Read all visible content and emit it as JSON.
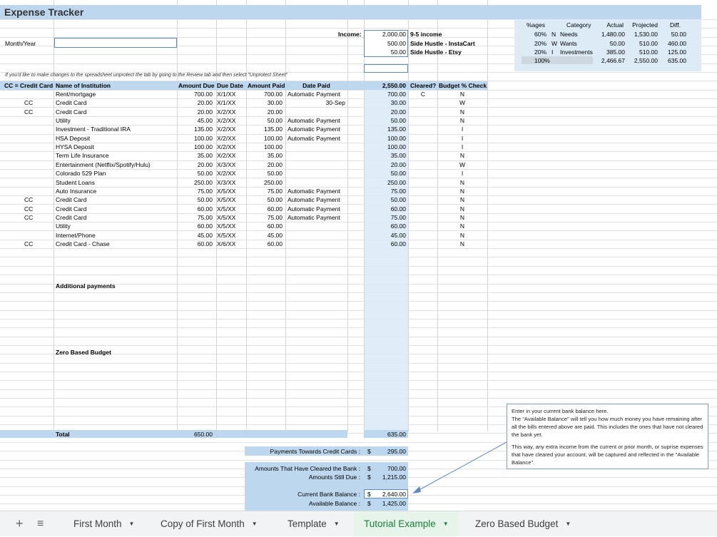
{
  "title": "Expense Tracker",
  "month_year_label": "Month/Year",
  "month_year_value": "",
  "income": {
    "label": "Income:",
    "rows": [
      {
        "amount": "2,000.00",
        "source": "9-5 income"
      },
      {
        "amount": "500.00",
        "source": "Side Hustle - InstaCart"
      },
      {
        "amount": "50.00",
        "source": "Side Hustle - Etsy"
      }
    ]
  },
  "budget_summary": {
    "headers": [
      "%ages",
      "Category",
      "Actual",
      "Projected",
      "Diff."
    ],
    "rows": [
      {
        "pct": "60%",
        "code": "N",
        "category": "Needs",
        "actual": "1,480.00",
        "projected": "1,530.00",
        "diff": "50.00"
      },
      {
        "pct": "20%",
        "code": "W",
        "category": "Wants",
        "actual": "50.00",
        "projected": "510.00",
        "diff": "460.00"
      },
      {
        "pct": "20%",
        "code": "I",
        "category": "Investments",
        "actual": "385.00",
        "projected": "510.00",
        "diff": "125.00"
      }
    ],
    "total": {
      "pct": "100%",
      "actual": "2,466.67",
      "projected": "2,550.00",
      "diff": "635.00"
    }
  },
  "instruction": "If you'd like to make changes to the spreadsheet unprotect the tab by going to the Review tab and then select \"Unprotect Sheet\"",
  "table": {
    "headers": {
      "cc": "CC = Credit Card",
      "name": "Name of Institution",
      "due": "Amount Due",
      "date": "Due Date",
      "paid": "Amount Paid",
      "datepaid": "Date Paid",
      "balance": "2,550.00",
      "cleared": "Cleared?",
      "check": "Budget % Check"
    },
    "rows": [
      {
        "cc": "",
        "name": "Rent/mortgage",
        "due": "700.00",
        "date": "X/1/XX",
        "paid": "700.00",
        "note": "Automatic Payment",
        "bal": "700.00",
        "cleared": "C",
        "check": "N"
      },
      {
        "cc": "CC",
        "name": "Credit Card",
        "due": "20.00",
        "date": "X/1/XX",
        "paid": "30.00",
        "note": "30-Sep",
        "bal": "30.00",
        "cleared": "",
        "check": "W"
      },
      {
        "cc": "CC",
        "name": "Credit Card",
        "due": "20.00",
        "date": "X/2/XX",
        "paid": "20.00",
        "note": "",
        "bal": "20.00",
        "cleared": "",
        "check": "N"
      },
      {
        "cc": "",
        "name": "Utility",
        "due": "45.00",
        "date": "X/2/XX",
        "paid": "50.00",
        "note": "Automatic Payment",
        "bal": "50.00",
        "cleared": "",
        "check": "N"
      },
      {
        "cc": "",
        "name": "Investment - Traditional IRA",
        "due": "135.00",
        "date": "X/2/XX",
        "paid": "135.00",
        "note": "Automatic Payment",
        "bal": "135.00",
        "cleared": "",
        "check": "I"
      },
      {
        "cc": "",
        "name": "HSA Deposit",
        "due": "100.00",
        "date": "X/2/XX",
        "paid": "100.00",
        "note": "Automatic Payment",
        "bal": "100.00",
        "cleared": "",
        "check": "I"
      },
      {
        "cc": "",
        "name": "HYSA Deposit",
        "due": "100.00",
        "date": "X/2/XX",
        "paid": "100.00",
        "note": "",
        "bal": "100.00",
        "cleared": "",
        "check": "I"
      },
      {
        "cc": "",
        "name": "Term Life Insurance",
        "due": "35.00",
        "date": "X/2/XX",
        "paid": "35.00",
        "note": "",
        "bal": "35.00",
        "cleared": "",
        "check": "N"
      },
      {
        "cc": "",
        "name": "Entertainment (Netflix/Spotify/Hulu)",
        "due": "20.00",
        "date": "X/3/XX",
        "paid": "20.00",
        "note": "",
        "bal": "20.00",
        "cleared": "",
        "check": "W"
      },
      {
        "cc": "",
        "name": "Colorado 529 Plan",
        "due": "50.00",
        "date": "X/2/XX",
        "paid": "50.00",
        "note": "",
        "bal": "50.00",
        "cleared": "",
        "check": "I"
      },
      {
        "cc": "",
        "name": "Student Loans",
        "due": "250.00",
        "date": "X/3/XX",
        "paid": "250.00",
        "note": "",
        "bal": "250.00",
        "cleared": "",
        "check": "N"
      },
      {
        "cc": "",
        "name": "Auto Insurance",
        "due": "75.00",
        "date": "X/5/XX",
        "paid": "75.00",
        "note": "Automatic Payment",
        "bal": "75.00",
        "cleared": "",
        "check": "N"
      },
      {
        "cc": "CC",
        "name": "Credit Card",
        "due": "50.00",
        "date": "X/5/XX",
        "paid": "50.00",
        "note": "Automatic Payment",
        "bal": "50.00",
        "cleared": "",
        "check": "N"
      },
      {
        "cc": "CC",
        "name": "Credit Card",
        "due": "60.00",
        "date": "X/5/XX",
        "paid": "60.00",
        "note": "Automatic Payment",
        "bal": "60.00",
        "cleared": "",
        "check": "N"
      },
      {
        "cc": "CC",
        "name": "Credit Card",
        "due": "75.00",
        "date": "X/5/XX",
        "paid": "75.00",
        "note": "Automatic Payment",
        "bal": "75.00",
        "cleared": "",
        "check": "N"
      },
      {
        "cc": "",
        "name": "Utility",
        "due": "60.00",
        "date": "X/5/XX",
        "paid": "60.00",
        "note": "",
        "bal": "60.00",
        "cleared": "",
        "check": "N"
      },
      {
        "cc": "",
        "name": "Internet/Phone",
        "due": "45.00",
        "date": "X/5/XX",
        "paid": "45.00",
        "note": "",
        "bal": "45.00",
        "cleared": "",
        "check": "N"
      },
      {
        "cc": "CC",
        "name": "Credit Card - Chase",
        "due": "60.00",
        "date": "X/6/XX",
        "paid": "60.00",
        "note": "",
        "bal": "60.00",
        "cleared": "",
        "check": "N"
      }
    ]
  },
  "sections": {
    "additional": "Additional payments",
    "zero": "Zero Based Budget"
  },
  "totals": {
    "label": "Total",
    "due": "650.00",
    "balance": "635.00"
  },
  "summary": {
    "cc_payments_label": "Payments Towards Credit Cards :",
    "cc_payments_value": "295.00",
    "cleared_label": "Amounts That Have Cleared the Bank :",
    "cleared_value": "700.00",
    "still_due_label": "Amounts Still Due :",
    "still_due_value": "1,215.00",
    "bank_balance_label": "Current Bank Balance :",
    "bank_balance_value": "2,640.00",
    "available_label": "Available Balance :",
    "available_value": "1,425.00",
    "currency": "$"
  },
  "note": {
    "line1": "Enter in your current bank balance here.",
    "line2": "The \"Available Balance\" will tell you how much money you have remaining after all the bills entered above are paid. This includes the ones that have not cleared the bank yet.",
    "line3": "This way, any extra income from the current or prior month, or suprise expenses that have cleared your account, will be captured and reflected in the \"Available Balance\"."
  },
  "tabs": [
    "First Month",
    "Copy of First Month",
    "Template",
    "Tutorial Example",
    "Zero Based Budget"
  ],
  "active_tab": "Tutorial Example",
  "colors": {
    "header_blue": "#bdd7ee",
    "light_blue": "#ddebf7",
    "active_tab_text": "#188038"
  }
}
